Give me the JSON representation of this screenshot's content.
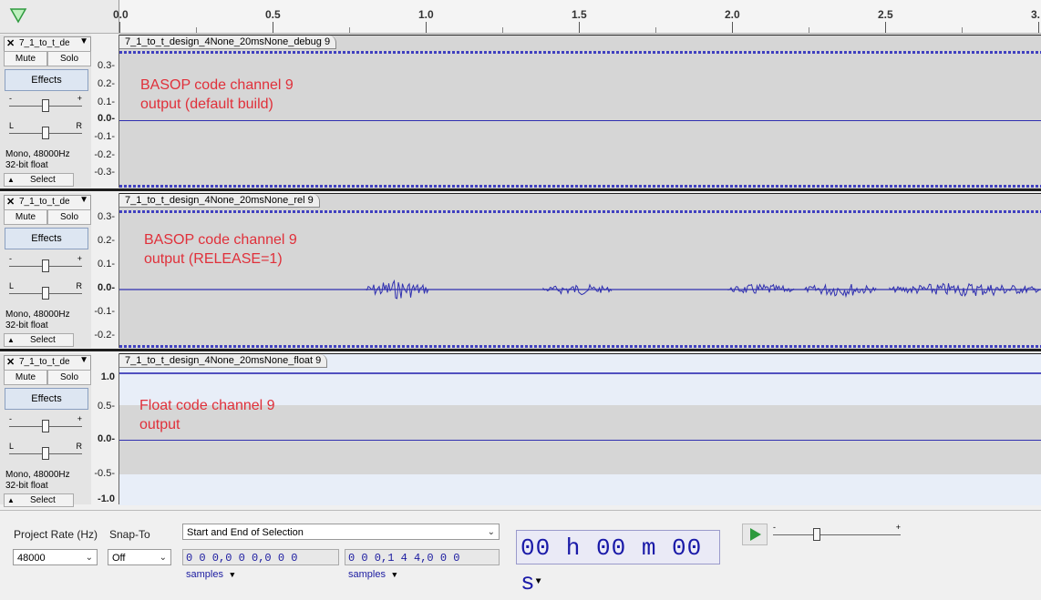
{
  "timeline": {
    "ticks": [
      "0.0",
      "0.5",
      "1.0",
      "1.5",
      "2.0",
      "2.5",
      "3."
    ]
  },
  "tracks": [
    {
      "short_name": "7_1_to_t_de",
      "clip_name": "7_1_to_t_design_4None_20msNone_debug 9",
      "mute": "Mute",
      "solo": "Solo",
      "effects": "Effects",
      "gain_plus": "+",
      "gain_minus": "-",
      "pan_l": "L",
      "pan_r": "R",
      "info_rate": "Mono, 48000Hz",
      "info_fmt": "32-bit float",
      "select": "Select",
      "scale": [
        "0.3-",
        "0.2-",
        "0.1-",
        "0.0-",
        "-0.1-",
        "-0.2-",
        "-0.3-"
      ],
      "annotation_line1": "BASOP code channel 9",
      "annotation_line2": "output (default build)"
    },
    {
      "short_name": "7_1_to_t_de",
      "clip_name": "7_1_to_t_design_4None_20msNone_rel 9",
      "mute": "Mute",
      "solo": "Solo",
      "effects": "Effects",
      "gain_plus": "+",
      "gain_minus": "-",
      "pan_l": "L",
      "pan_r": "R",
      "info_rate": "Mono, 48000Hz",
      "info_fmt": "32-bit float",
      "select": "Select",
      "scale": [
        "0.3-",
        "0.2-",
        "0.1-",
        "0.0-",
        "-0.1-",
        "-0.2-"
      ],
      "annotation_line1": "BASOP code channel 9",
      "annotation_line2": "output (RELEASE=1)"
    },
    {
      "short_name": "7_1_to_t_de",
      "clip_name": "7_1_to_t_design_4None_20msNone_float 9",
      "mute": "Mute",
      "solo": "Solo",
      "effects": "Effects",
      "gain_plus": "+",
      "gain_minus": "-",
      "pan_l": "L",
      "pan_r": "R",
      "info_rate": "Mono, 48000Hz",
      "info_fmt": "32-bit float",
      "select": "Select",
      "scale": [
        "1.0",
        "0.5-",
        "0.0-",
        "-0.5-",
        "-1.0"
      ],
      "annotation_line1": "Float code channel 9",
      "annotation_line2": "output"
    }
  ],
  "selection_toolbar": {
    "project_rate_label": "Project Rate (Hz)",
    "snap_to_label": "Snap-To",
    "project_rate_value": "48000",
    "snap_to_value": "Off",
    "selection_mode": "Start and End of Selection",
    "start_time": "0 0 0,0 0 0,0 0 0",
    "end_time": "0 0 0,1 4 4,0 0 0",
    "time_unit": "samples",
    "big_time": "00 h 00 m 00 s"
  },
  "colors": {
    "waveform": "#3030b0",
    "annotation": "#e0303a",
    "track_bg": "#d6d6d6",
    "play_green": "#2e9a3e"
  }
}
